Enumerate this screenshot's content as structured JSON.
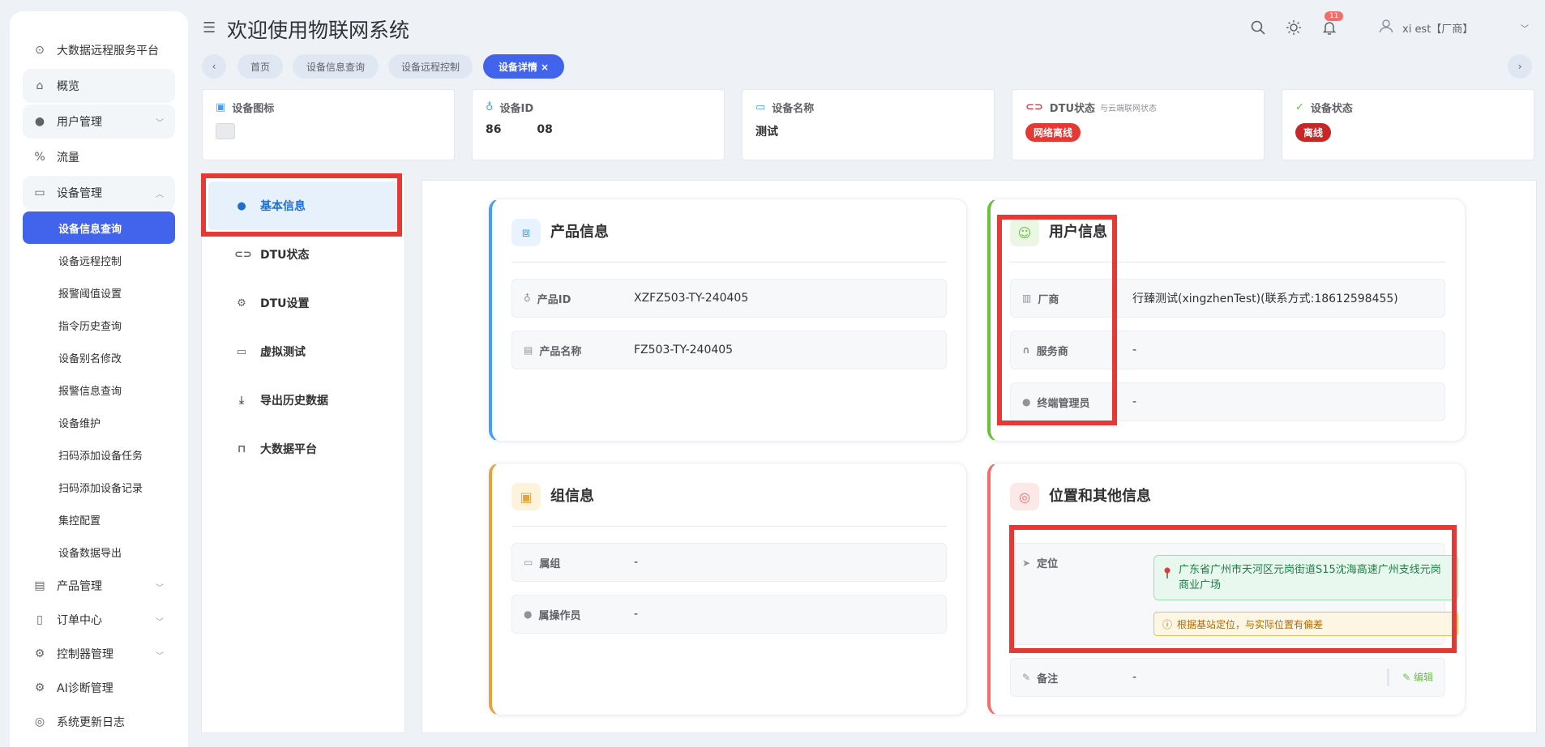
{
  "sidebar": {
    "items": [
      {
        "label": "大数据远程服务平台",
        "icon": "monitor-icon",
        "glyph": "⊙",
        "soft": false
      },
      {
        "label": "概览",
        "icon": "home-icon",
        "glyph": "⌂",
        "soft": true
      },
      {
        "label": "用户管理",
        "icon": "user-icon",
        "glyph": "●",
        "soft": true,
        "chevron": "﹀"
      },
      {
        "label": "流量",
        "icon": "traffic-icon",
        "glyph": "%",
        "soft": false
      },
      {
        "label": "设备管理",
        "icon": "device-icon",
        "glyph": "▭",
        "soft": true,
        "chevron": "︿"
      }
    ],
    "sub_items": [
      {
        "label": "设备信息查询",
        "active": true
      },
      {
        "label": "设备远程控制"
      },
      {
        "label": "报警阈值设置"
      },
      {
        "label": "指令历史查询"
      },
      {
        "label": "设备别名修改"
      },
      {
        "label": "报警信息查询"
      },
      {
        "label": "设备维护"
      },
      {
        "label": "扫码添加设备任务"
      },
      {
        "label": "扫码添加设备记录"
      },
      {
        "label": "集控配置"
      },
      {
        "label": "设备数据导出"
      }
    ],
    "bottom_items": [
      {
        "label": "产品管理",
        "icon": "product-icon",
        "glyph": "▤",
        "chevron": "﹀"
      },
      {
        "label": "订单中心",
        "icon": "order-icon",
        "glyph": "▯",
        "chevron": "﹀"
      },
      {
        "label": "控制器管理",
        "icon": "controller-gear-icon",
        "glyph": "⚙",
        "chevron": "﹀"
      },
      {
        "label": "AI诊断管理",
        "icon": "ai-gear-icon",
        "glyph": "⚙"
      },
      {
        "label": "系统更新日志",
        "icon": "log-icon",
        "glyph": "◎"
      }
    ]
  },
  "header": {
    "title": "欢迎使用物联网系统",
    "notification_count": "11",
    "user_label": "xi    est【厂商】"
  },
  "tabs": [
    {
      "label": "首页",
      "active": false
    },
    {
      "label": "设备信息查询",
      "active": false
    },
    {
      "label": "设备远程控制",
      "active": false
    },
    {
      "label": "设备详情 ×",
      "active": true
    }
  ],
  "top_cards": {
    "device_icon": {
      "label": "设备图标"
    },
    "device_id": {
      "label": "设备ID",
      "value": "86         08"
    },
    "device_name": {
      "label": "设备名称",
      "value": "测试"
    },
    "dtu_status": {
      "label": "DTU状态",
      "note": "与云端联网状态",
      "value": "网络离线"
    },
    "device_status": {
      "label": "设备状态",
      "value": "离线"
    }
  },
  "detail_menu": [
    {
      "label": "基本信息",
      "icon": "info-icon",
      "glyph": "●",
      "active": true
    },
    {
      "label": "DTU状态",
      "icon": "link-icon",
      "glyph": "⊂⊃"
    },
    {
      "label": "DTU设置",
      "icon": "settings-icon",
      "glyph": "⚙"
    },
    {
      "label": "虚拟测试",
      "icon": "screen-icon",
      "glyph": "▭"
    },
    {
      "label": "导出历史数据",
      "icon": "download-icon",
      "glyph": "⤓"
    },
    {
      "label": "大数据平台",
      "icon": "platform-icon",
      "glyph": "⊓"
    }
  ],
  "product_info": {
    "title": "产品信息",
    "rows": [
      {
        "label": "产品ID",
        "value": "XZFZ503-TY-240405",
        "icon": "key-icon",
        "glyph": "♁"
      },
      {
        "label": "产品名称",
        "value": "FZ503-TY-240405",
        "icon": "doc-icon",
        "glyph": "▤"
      }
    ]
  },
  "user_info": {
    "title": "用户信息",
    "rows": [
      {
        "label": "厂商",
        "value": "行臻测试(xingzhenTest)(联系方式:18612598455)",
        "icon": "building-icon",
        "glyph": "▥"
      },
      {
        "label": "服务商",
        "value": "-",
        "icon": "headset-icon",
        "glyph": "∩"
      },
      {
        "label": "终端管理员",
        "value": "-",
        "icon": "person-icon",
        "glyph": "●"
      }
    ]
  },
  "group_info": {
    "title": "组信息",
    "rows": [
      {
        "label": "属组",
        "value": "-",
        "icon": "folder-icon",
        "glyph": "▭"
      },
      {
        "label": "属操作员",
        "value": "-",
        "icon": "operator-icon",
        "glyph": "●"
      }
    ]
  },
  "location_info": {
    "title": "位置和其他信息",
    "location_label": "定位",
    "location_value": "广东省广州市天河区元岗街道S15沈海高速广州支线元岗商业广场",
    "warning": "根据基站定位，与实际位置有偏差",
    "remark_label": "备注",
    "remark_value": "-",
    "edit_label": "编辑"
  },
  "colors": {
    "accent": "#4263eb",
    "annotation": "#e53935",
    "success": "#67c23a",
    "danger": "#e53935"
  }
}
